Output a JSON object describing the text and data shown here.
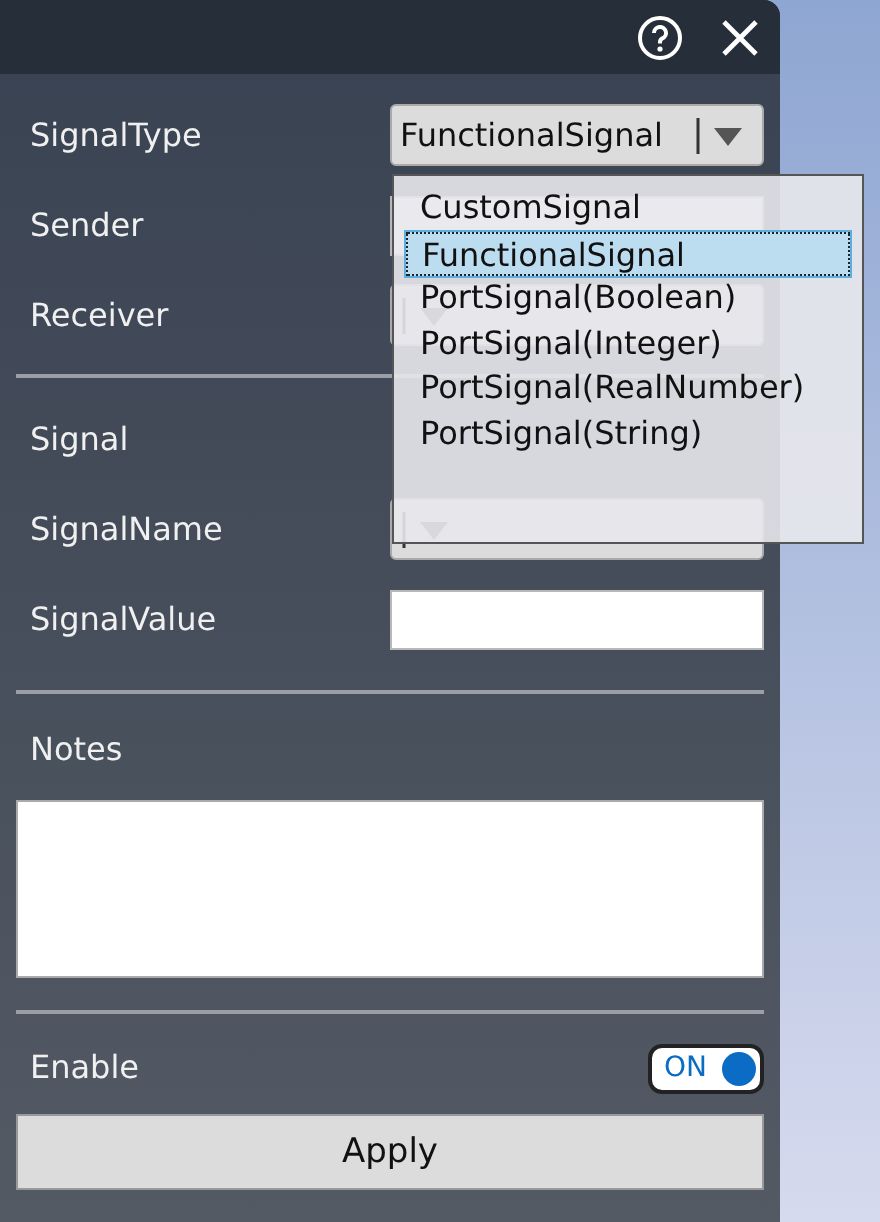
{
  "groups": [
    [
      {
        "label": "SignalType",
        "kind": "combo",
        "value": "FunctionalSignal"
      },
      {
        "label": "Sender",
        "kind": "text"
      },
      {
        "label": "Receiver",
        "kind": "combo"
      }
    ],
    [
      {
        "label": "Signal",
        "kind": "none"
      },
      {
        "label": "SignalName",
        "kind": "combo"
      },
      {
        "label": "SignalValue",
        "kind": "text"
      }
    ]
  ],
  "dropdown": {
    "options": [
      {
        "label": "CustomSignal",
        "selected": false
      },
      {
        "label": "FunctionalSignal",
        "selected": true
      },
      {
        "label": "PortSignal(Boolean)",
        "selected": false
      },
      {
        "label": "PortSignal(Integer)",
        "selected": false
      },
      {
        "label": "PortSignal(RealNumber)",
        "selected": false
      },
      {
        "label": "PortSignal(String)",
        "selected": false
      }
    ]
  },
  "notes": {
    "label": "Notes"
  },
  "enable": {
    "label": "Enable",
    "on": true,
    "on_text": "ON"
  },
  "apply_button": "Apply"
}
